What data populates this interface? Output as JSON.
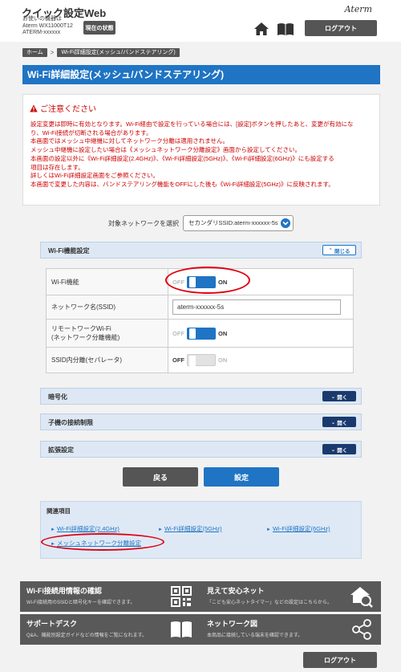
{
  "header": {
    "app_title": "クイック設定Web",
    "device_label": "お使いの機器は",
    "device_model": "Aterm WX11000T12",
    "device_name": "ATERM-xxxxxx",
    "status_button": "現在の状態",
    "brand": "Aterm",
    "logout": "ログアウト"
  },
  "breadcrumb": {
    "home": "ホーム",
    "current": "Wi-Fi詳細設定(メッシュ/バンドステアリング)"
  },
  "page_title": "Wi-Fi詳細設定(メッシュ/バンドステアリング)",
  "notice": {
    "heading": "ご注意ください",
    "lines": [
      "設定変更は即時に有効となります。Wi-Fi経由で設定を行っている場合には、[設定]ボタンを押したあと、変更が有効にな",
      "り、Wi-Fi接続が切断される場合があります。",
      "本画面ではメッシュ中継機に対してネットワーク分離は適用されません。",
      "メッシュ中継機に設定したい場合は《メッシュネットワーク分離設定》画面から設定してください。",
      "本画面の設定以外に《Wi-Fi詳細設定(2.4GHz)》、《Wi-Fi詳細設定(5GHz)》、《Wi-Fi詳細設定(6GHz)》にも設定する",
      "項目は存在します。",
      "詳しくはWi-Fi詳細設定画面をご参照ください。",
      "本画面で変更した内容は、バンドステアリング機能をOFFにした後も《Wi-Fi詳細設定(5GHz)》に反映されます。"
    ]
  },
  "target": {
    "label": "対象ネットワークを選択",
    "selected": "セカンダリSSID:aterm-xxxxxx-5s"
  },
  "wifi_panel": {
    "title": "Wi-Fi機能設定",
    "toggle": "閉じる",
    "rows": {
      "wifi_func": {
        "label": "Wi-Fi機能",
        "off": "OFF",
        "on": "ON",
        "state": "on"
      },
      "ssid": {
        "label": "ネットワーク名(SSID)",
        "value": "aterm-xxxxxx-5s"
      },
      "remote": {
        "label1": "リモートワークWi-Fi",
        "label2": "(ネットワーク分離機能)",
        "off": "OFF",
        "on": "ON",
        "state": "on"
      },
      "separator": {
        "label": "SSID内分離(セパレータ)",
        "off": "OFF",
        "on": "ON",
        "state": "off"
      }
    }
  },
  "panels": {
    "encryption": {
      "title": "暗号化",
      "toggle": "開く"
    },
    "restriction": {
      "title": "子機の接続制限",
      "toggle": "開く"
    },
    "advanced": {
      "title": "拡張設定",
      "toggle": "開く"
    }
  },
  "actions": {
    "back": "戻る",
    "apply": "設定"
  },
  "related": {
    "title": "関連項目",
    "links": [
      "Wi-Fi詳細設定(2.4GHz)",
      "Wi-Fi詳細設定(5GHz)",
      "Wi-Fi詳細設定(6GHz)",
      "メッシュネットワーク分離設定"
    ]
  },
  "cards": {
    "wifi_info": {
      "title": "Wi-Fi接続用情報の確認",
      "desc": "Wi-Fi接続用のSSIDと暗号化キーを確認できます。"
    },
    "safety_net": {
      "title": "見えて安心ネット",
      "desc": "「こども安心ネットタイマー」などの設定はこちらから。"
    },
    "support": {
      "title": "サポートデスク",
      "desc": "Q&A、機能別設定ガイドなどの情報をご覧になれます。"
    },
    "network_map": {
      "title": "ネットワーク図",
      "desc": "本商品に接続している端末を確認できます。"
    }
  },
  "footer": {
    "logout": "ログアウト"
  },
  "colors": {
    "accent": "#1f74c4",
    "warning": "#cc0000",
    "highlight": "#e00010"
  }
}
